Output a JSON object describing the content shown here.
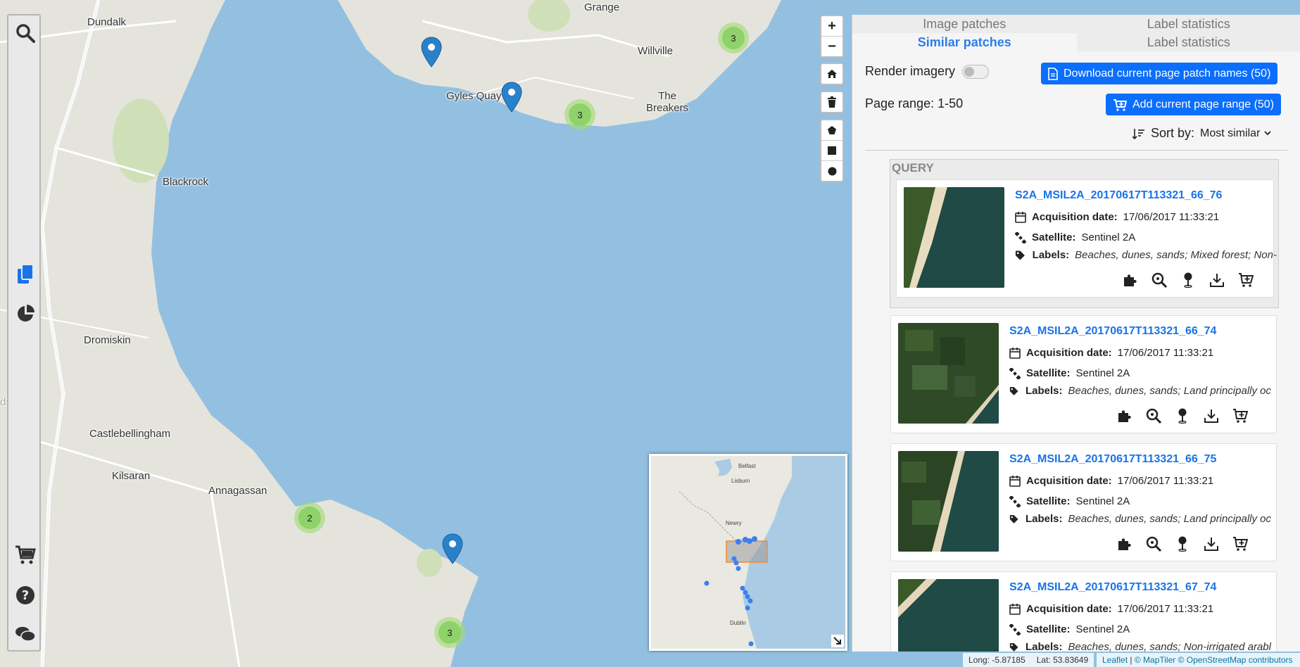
{
  "map": {
    "places": [
      {
        "name": "Dundalk"
      },
      {
        "name": "Grange"
      },
      {
        "name": "Willville"
      },
      {
        "name": "Gyles Quay"
      },
      {
        "name": "The\nBreakers"
      },
      {
        "name": "Blackrock"
      },
      {
        "name": "Dromiskin"
      },
      {
        "name": "Castlebellingham"
      },
      {
        "name": "Kilsaran"
      },
      {
        "name": "Annagassan"
      },
      {
        "name": "dstown"
      }
    ],
    "clusters": [
      {
        "count": "3"
      },
      {
        "count": "3"
      },
      {
        "count": "2"
      },
      {
        "count": "3"
      }
    ],
    "controls": {
      "zoom_in": "+",
      "zoom_out": "−"
    },
    "minimap": {
      "labels": [
        "Belfast",
        "Lisburn",
        "Newry",
        "Dublin"
      ]
    },
    "coords": {
      "long": "Long: -5.87185",
      "lat": "Lat: 53.83649"
    },
    "attribution": {
      "leaflet": "Leaflet",
      "sep": "|",
      "maptiler": "© MapTiler",
      "osm": "© OpenStreetMap contributors"
    }
  },
  "sidebar": {
    "icons": [
      "search-icon",
      "documents-icon",
      "pie-chart-icon",
      "cart-icon",
      "help-icon",
      "chat-icon"
    ]
  },
  "panel": {
    "tabs_top": [
      "Image patches",
      "Label statistics"
    ],
    "tabs_bottom": [
      "Similar patches",
      "Label statistics"
    ],
    "render_imagery": "Render imagery",
    "download_button": "Download current page patch names (50)",
    "page_range": "Page range: 1-50",
    "add_button": "Add current page range (50)",
    "sort_label": "Sort by:",
    "sort_value": "Most similar",
    "query_label": "QUERY",
    "field_labels": {
      "date": "Acquisition date:",
      "satellite": "Satellite:",
      "labels": "Labels:"
    },
    "patches": [
      {
        "name": "S2A_MSIL2A_20170617T113321_66_76",
        "date": "17/06/2017 11:33:21",
        "satellite": "Sentinel 2A",
        "labels": "Beaches, dunes, sands; Mixed forest; Non-"
      },
      {
        "name": "S2A_MSIL2A_20170617T113321_66_74",
        "date": "17/06/2017 11:33:21",
        "satellite": "Sentinel 2A",
        "labels": "Beaches, dunes, sands; Land principally oc"
      },
      {
        "name": "S2A_MSIL2A_20170617T113321_66_75",
        "date": "17/06/2017 11:33:21",
        "satellite": "Sentinel 2A",
        "labels": "Beaches, dunes, sands; Land principally oc"
      },
      {
        "name": "S2A_MSIL2A_20170617T113321_67_74",
        "date": "17/06/2017 11:33:21",
        "satellite": "Sentinel 2A",
        "labels": "Beaches, dunes, sands; Non-irrigated arabl"
      }
    ]
  }
}
